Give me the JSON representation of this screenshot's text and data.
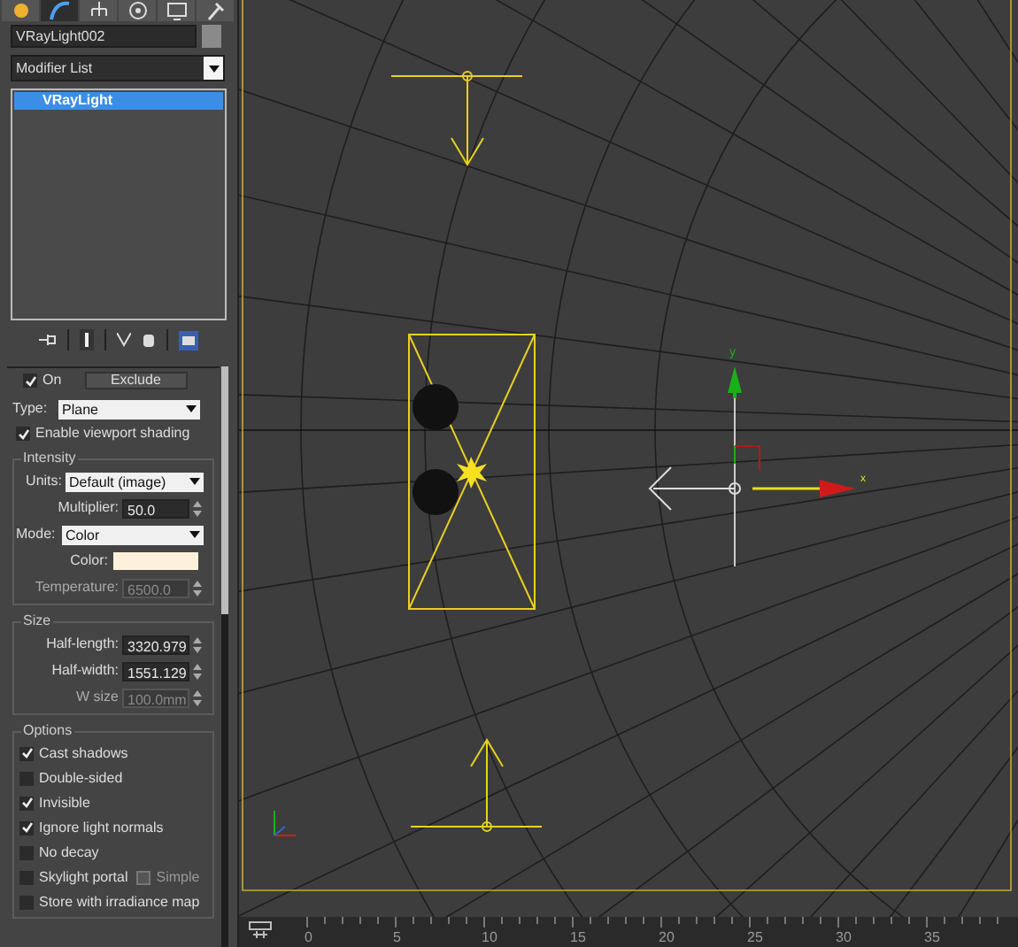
{
  "command_tabs": [
    {
      "kind": "create",
      "selected": false
    },
    {
      "kind": "modify",
      "selected": true
    },
    {
      "kind": "hierarchy",
      "selected": false
    },
    {
      "kind": "motion",
      "selected": false
    },
    {
      "kind": "display",
      "selected": false
    },
    {
      "kind": "utilities",
      "selected": false
    }
  ],
  "object_name": "VRayLight002",
  "modifier_list": "Modifier List",
  "modifier_stack": [
    {
      "label": "VRayLight",
      "selected": true
    }
  ],
  "general": {
    "on": {
      "label": "On",
      "checked": true
    },
    "exclude_button": "Exclude",
    "type": {
      "label": "Type:",
      "value": "Plane"
    },
    "viewport_shading": {
      "label": "Enable viewport shading",
      "checked": true
    }
  },
  "intensity": {
    "title": "Intensity",
    "units": {
      "label": "Units:",
      "value": "Default (image)"
    },
    "multiplier": {
      "label": "Multiplier:",
      "value": "50.0",
      "disabled": false
    },
    "mode": {
      "label": "Mode:",
      "value": "Color"
    },
    "color": {
      "label": "Color:"
    },
    "temperature": {
      "label": "Temperature:",
      "value": "6500.0",
      "disabled": true
    }
  },
  "size": {
    "title": "Size",
    "fields": [
      {
        "label": "Half-length:",
        "value": "3320.979",
        "disabled": false
      },
      {
        "label": "Half-width:",
        "value": "1551.129",
        "disabled": false
      },
      {
        "label": "W size",
        "value": "100.0mm",
        "disabled": true
      }
    ]
  },
  "options": {
    "title": "Options",
    "items": [
      {
        "label": "Cast shadows",
        "checked": true
      },
      {
        "label": "Double-sided",
        "checked": false
      },
      {
        "label": "Invisible",
        "checked": true
      },
      {
        "label": "Ignore light normals",
        "checked": true
      },
      {
        "label": "No decay",
        "checked": false
      },
      {
        "label": "Skylight portal",
        "checked": false,
        "simple": {
          "label": "Simple",
          "checked": false,
          "disabled": true
        }
      },
      {
        "label": "Store with irradiance map",
        "checked": false
      }
    ]
  },
  "gizmo": {
    "y_label": "y",
    "x_label": "x"
  },
  "ruler": {
    "ticks": [
      "0",
      "5",
      "10",
      "15",
      "20",
      "25",
      "30",
      "35"
    ]
  }
}
